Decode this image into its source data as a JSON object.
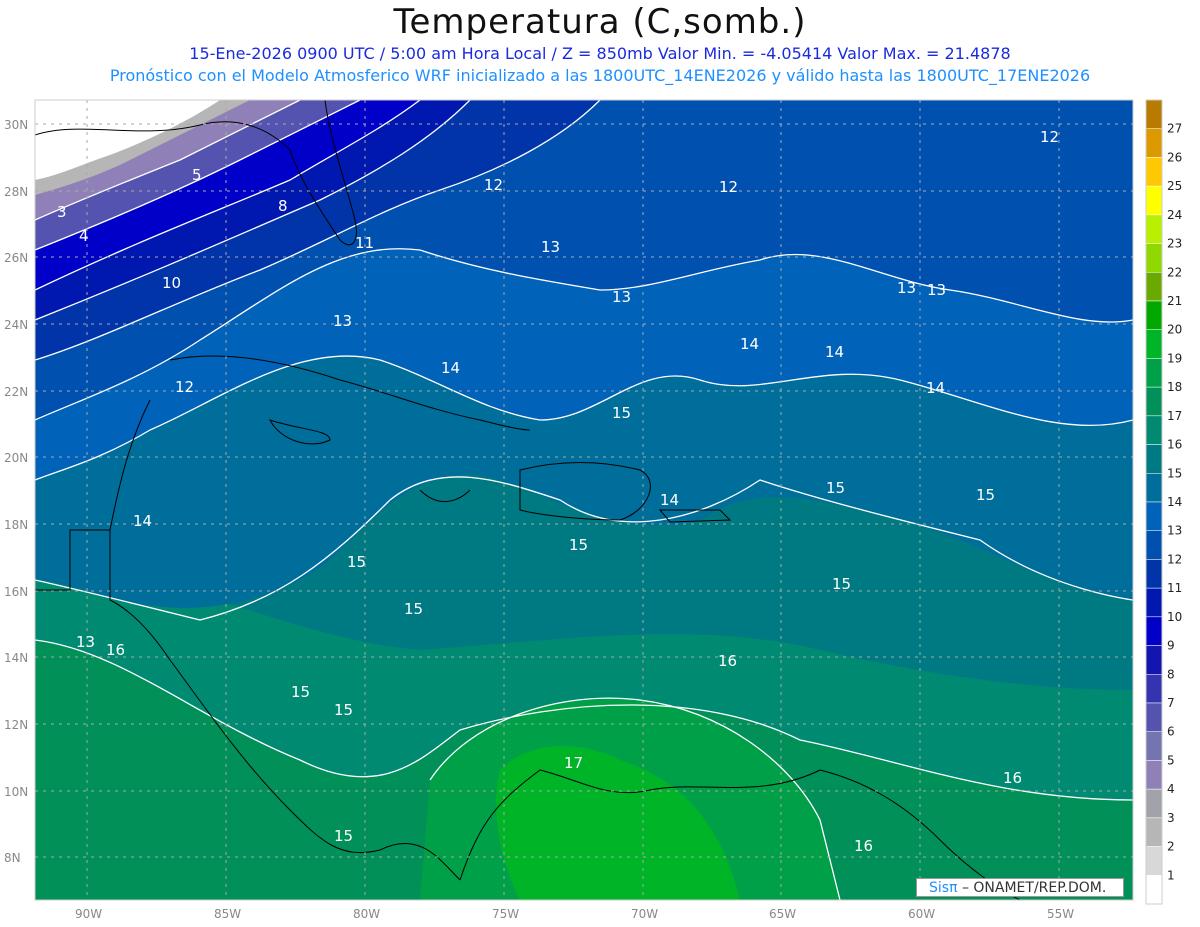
{
  "header": {
    "title": "Temperatura (C,somb.)",
    "subtitle": "15-Ene-2026  0900 UTC / 5:00 am Hora Local / Z = 850mb   Valor Min. = -4.05414  Valor Max. = 21.4878",
    "model_info": "Pronóstico con el Modelo Atmosferico WRF inicializado a las 1800UTC_14ENE2026 y válido hasta las  1800UTC_17ENE2026"
  },
  "map": {
    "variable": "Temperatura",
    "units": "C",
    "level": "850mb",
    "valid": "15-Ene-2026 0900 UTC",
    "min_value": -4.05414,
    "max_value": 21.4878,
    "lon_ticks": [
      "90W",
      "85W",
      "80W",
      "75W",
      "70W",
      "65W",
      "60W",
      "55W"
    ],
    "lat_ticks": [
      "30N",
      "28N",
      "26N",
      "24N",
      "22N",
      "20N",
      "18N",
      "16N",
      "14N",
      "12N",
      "10N",
      "8N"
    ],
    "contour_labels": [
      "12",
      "5",
      "12",
      "12",
      "3",
      "8",
      "4",
      "11",
      "13",
      "10",
      "13",
      "13",
      "13",
      "13",
      "14",
      "14",
      "12",
      "14",
      "14",
      "15",
      "15",
      "15",
      "14",
      "14",
      "15",
      "15",
      "15",
      "15",
      "13",
      "16",
      "16",
      "15",
      "15",
      "17",
      "16",
      "15",
      "16"
    ]
  },
  "colorbar": {
    "labels": [
      "27",
      "26",
      "25",
      "24",
      "23",
      "22",
      "21",
      "20",
      "19",
      "18",
      "17",
      "16",
      "15",
      "14",
      "13",
      "12",
      "11",
      "10",
      "9",
      "8",
      "7",
      "6",
      "5",
      "4",
      "3",
      "2",
      "1"
    ],
    "colors": [
      "#b87a00",
      "#dc9a00",
      "#ffc800",
      "#ffff00",
      "#b8f000",
      "#90d800",
      "#6aaa00",
      "#00a800",
      "#00b428",
      "#00a048",
      "#009058",
      "#008a72",
      "#007a82",
      "#006e9a",
      "#0062b8",
      "#0050b0",
      "#0034a8",
      "#0018b0",
      "#0000c8",
      "#1414b0",
      "#3434b0",
      "#5454b0",
      "#7474b0",
      "#9080b8",
      "#a2a2aa",
      "#b6b6b6",
      "#d8d8d8",
      "#ffffff"
    ]
  },
  "credit": {
    "logo": "Sisπ",
    "text": "– ONAMET/REP.DOM."
  }
}
